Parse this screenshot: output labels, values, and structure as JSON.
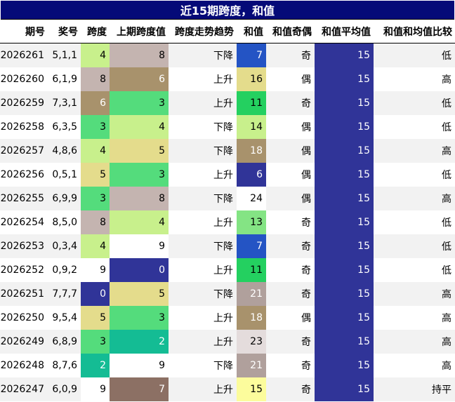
{
  "title": "近15期跨度，和值",
  "columns": [
    "期号",
    "奖号",
    "跨度",
    "上期跨度值",
    "跨度走势趋势",
    "和值",
    "和值奇偶",
    "和值平均值",
    "和值和均值比较"
  ],
  "rows": [
    {
      "period": "2026261",
      "numbers": "5,1,1",
      "span": "4",
      "prev_span": "8",
      "trend": "下降",
      "sum": "7",
      "parity": "奇",
      "avg": "15",
      "compare": "低",
      "span_color": "#c8f08c",
      "prev_color": "#c4b4b0",
      "sum_color": "#2454c4",
      "span_light": false,
      "prev_light": false,
      "sum_light": true
    },
    {
      "period": "2026260",
      "numbers": "6,1,9",
      "span": "8",
      "prev_span": "6",
      "trend": "上升",
      "sum": "16",
      "parity": "偶",
      "avg": "15",
      "compare": "高",
      "span_color": "#c4b4b0",
      "prev_color": "#a8926c",
      "sum_color": "#e4dc8c",
      "span_light": false,
      "prev_light": true,
      "sum_light": false
    },
    {
      "period": "2026259",
      "numbers": "7,3,1",
      "span": "6",
      "prev_span": "3",
      "trend": "上升",
      "sum": "11",
      "parity": "奇",
      "avg": "15",
      "compare": "低",
      "span_color": "#a8926c",
      "prev_color": "#54dc7c",
      "sum_color": "#24d060",
      "span_light": true,
      "prev_light": false,
      "sum_light": false
    },
    {
      "period": "2026258",
      "numbers": "6,3,5",
      "span": "3",
      "prev_span": "4",
      "trend": "下降",
      "sum": "14",
      "parity": "偶",
      "avg": "15",
      "compare": "低",
      "span_color": "#54dc7c",
      "prev_color": "#c8f08c",
      "sum_color": "#c8f08c",
      "span_light": false,
      "prev_light": false,
      "sum_light": false
    },
    {
      "period": "2026257",
      "numbers": "4,8,6",
      "span": "4",
      "prev_span": "5",
      "trend": "下降",
      "sum": "18",
      "parity": "偶",
      "avg": "15",
      "compare": "高",
      "span_color": "#c8f08c",
      "prev_color": "#e4dc8c",
      "sum_color": "#a8926c",
      "span_light": false,
      "prev_light": false,
      "sum_light": true
    },
    {
      "period": "2026256",
      "numbers": "0,5,1",
      "span": "5",
      "prev_span": "3",
      "trend": "上升",
      "sum": "6",
      "parity": "偶",
      "avg": "15",
      "compare": "低",
      "span_color": "#e4dc8c",
      "prev_color": "#54dc7c",
      "sum_color": "#303498",
      "span_light": false,
      "prev_light": false,
      "sum_light": true
    },
    {
      "period": "2026255",
      "numbers": "6,9,9",
      "span": "3",
      "prev_span": "8",
      "trend": "下降",
      "sum": "24",
      "parity": "偶",
      "avg": "15",
      "compare": "高",
      "span_color": "#54dc7c",
      "prev_color": "#c4b4b0",
      "sum_color": "#ffffff",
      "span_light": false,
      "prev_light": false,
      "sum_light": false
    },
    {
      "period": "2026254",
      "numbers": "8,5,0",
      "span": "8",
      "prev_span": "4",
      "trend": "上升",
      "sum": "13",
      "parity": "奇",
      "avg": "15",
      "compare": "低",
      "span_color": "#c4b4b0",
      "prev_color": "#c8f08c",
      "sum_color": "#84e484",
      "span_light": false,
      "prev_light": false,
      "sum_light": false
    },
    {
      "period": "2026253",
      "numbers": "0,3,4",
      "span": "4",
      "prev_span": "9",
      "trend": "下降",
      "sum": "7",
      "parity": "奇",
      "avg": "15",
      "compare": "低",
      "span_color": "#c8f08c",
      "prev_color": "#ffffff",
      "sum_color": "#2454c4",
      "span_light": false,
      "prev_light": false,
      "sum_light": true
    },
    {
      "period": "2026252",
      "numbers": "0,9,2",
      "span": "9",
      "prev_span": "0",
      "trend": "上升",
      "sum": "11",
      "parity": "奇",
      "avg": "15",
      "compare": "低",
      "span_color": "#ffffff",
      "prev_color": "#303498",
      "sum_color": "#24d060",
      "span_light": false,
      "prev_light": true,
      "sum_light": false
    },
    {
      "period": "2026251",
      "numbers": "7,7,7",
      "span": "0",
      "prev_span": "5",
      "trend": "下降",
      "sum": "21",
      "parity": "奇",
      "avg": "15",
      "compare": "高",
      "span_color": "#303498",
      "prev_color": "#e4dc8c",
      "sum_color": "#b0a09c",
      "span_light": true,
      "prev_light": false,
      "sum_light": true
    },
    {
      "period": "2026250",
      "numbers": "9,5,4",
      "span": "5",
      "prev_span": "3",
      "trend": "上升",
      "sum": "18",
      "parity": "偶",
      "avg": "15",
      "compare": "高",
      "span_color": "#e4dc8c",
      "prev_color": "#54dc7c",
      "sum_color": "#a8926c",
      "span_light": false,
      "prev_light": false,
      "sum_light": true
    },
    {
      "period": "2026249",
      "numbers": "6,8,9",
      "span": "3",
      "prev_span": "2",
      "trend": "上升",
      "sum": "23",
      "parity": "奇",
      "avg": "15",
      "compare": "高",
      "span_color": "#54dc7c",
      "prev_color": "#14bc94",
      "sum_color": "#e4dcdc",
      "span_light": false,
      "prev_light": true,
      "sum_light": false
    },
    {
      "period": "2026248",
      "numbers": "8,7,6",
      "span": "2",
      "prev_span": "9",
      "trend": "下降",
      "sum": "21",
      "parity": "奇",
      "avg": "15",
      "compare": "高",
      "span_color": "#14bc94",
      "prev_color": "#ffffff",
      "sum_color": "#b0a09c",
      "span_light": true,
      "prev_light": false,
      "sum_light": true
    },
    {
      "period": "2026247",
      "numbers": "6,0,9",
      "span": "9",
      "prev_span": "7",
      "trend": "上升",
      "sum": "15",
      "parity": "奇",
      "avg": "15",
      "compare": "持平",
      "span_color": "#ffffff",
      "prev_color": "#8c7064",
      "sum_color": "#fcfc9c",
      "span_light": false,
      "prev_light": true,
      "sum_light": false
    }
  ],
  "colors": {
    "title_bg": "#050a78",
    "avg_bg": "#303498",
    "stripe_bg": "#f2f2f2"
  }
}
